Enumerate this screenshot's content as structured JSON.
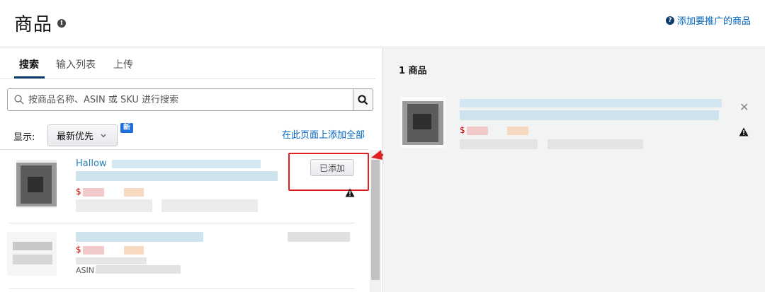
{
  "header": {
    "title": "商品",
    "add_link_label": "添加要推广的商品"
  },
  "tabs": [
    {
      "label": "搜索",
      "active": true
    },
    {
      "label": "输入列表",
      "active": false
    },
    {
      "label": "上传",
      "active": false
    }
  ],
  "search": {
    "placeholder": "按商品名称、ASIN 或 SKU 进行搜索",
    "value": ""
  },
  "sort": {
    "label": "显示:",
    "selected": "最新优先",
    "new_badge": "新"
  },
  "add_all_label": "在此页面上添加全部",
  "results": [
    {
      "title_visible": "Hallow",
      "price_symbol": "$",
      "status_button": "已添加",
      "warning": true
    },
    {
      "title_visible": "",
      "price_symbol": "$",
      "asin_label": "ASIN",
      "status_button": "",
      "warning": false
    }
  ],
  "right": {
    "count_label": "1 商品",
    "items": [
      {
        "price_symbol": "$",
        "warning": true
      }
    ]
  },
  "colors": {
    "link": "#0066c0",
    "highlight": "#e02020",
    "price": "#c40000",
    "tab_underline": "#0a3b6b"
  },
  "icons": [
    "info-icon",
    "help-icon",
    "search-icon",
    "chevron-down-icon",
    "warning-icon",
    "close-icon",
    "arrow-annotation"
  ]
}
